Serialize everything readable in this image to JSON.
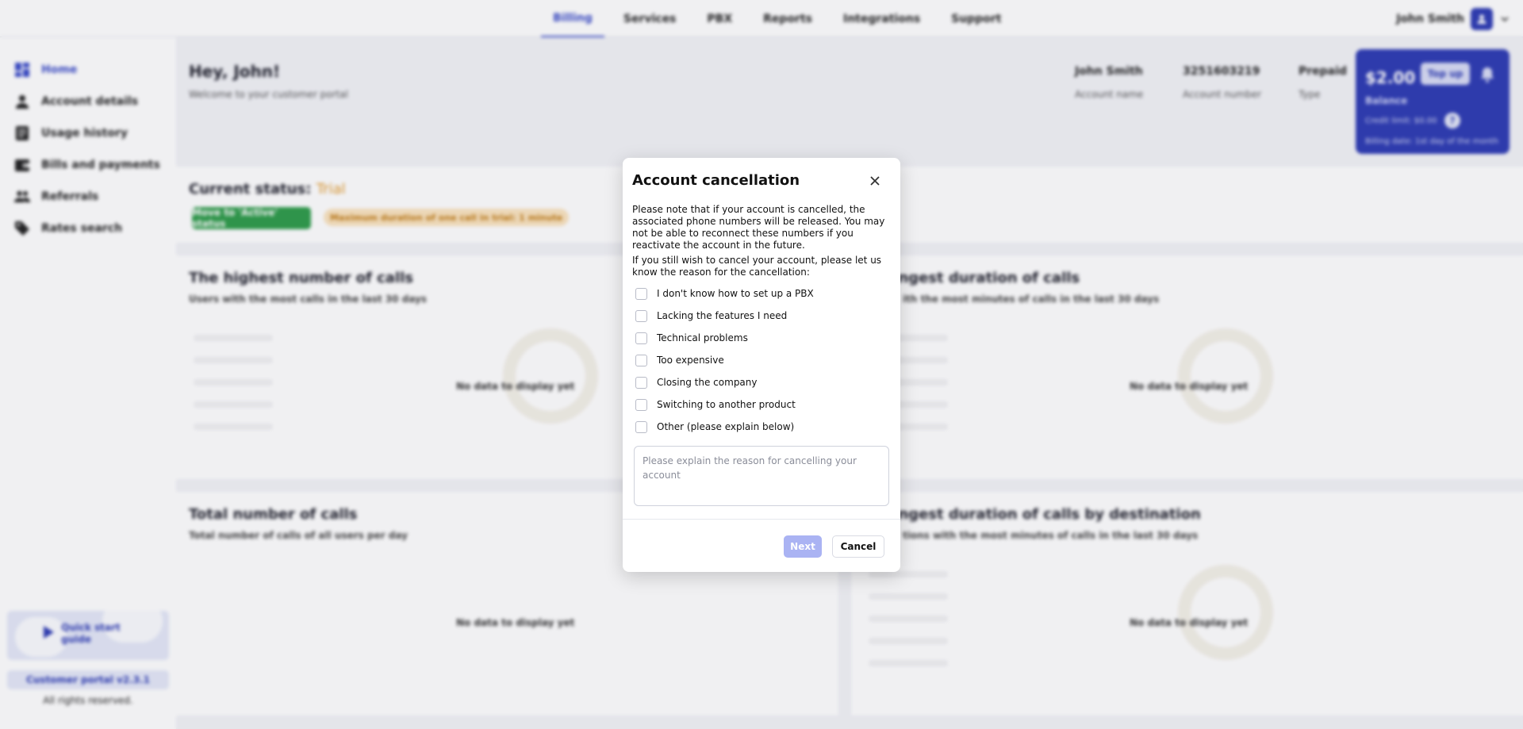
{
  "topnav": {
    "tabs": [
      {
        "label": "Billing",
        "active": true
      },
      {
        "label": "Services",
        "active": false
      },
      {
        "label": "PBX",
        "active": false
      },
      {
        "label": "Reports",
        "active": false
      },
      {
        "label": "Integrations",
        "active": false
      },
      {
        "label": "Support",
        "active": false
      }
    ],
    "user_name": "John Smith"
  },
  "sidebar": {
    "items": [
      {
        "label": "Home",
        "icon": "dashboard-icon",
        "active": true
      },
      {
        "label": "Account details",
        "icon": "user-icon",
        "active": false
      },
      {
        "label": "Usage history",
        "icon": "document-icon",
        "active": false
      },
      {
        "label": "Bills and payments",
        "icon": "wallet-icon",
        "active": false
      },
      {
        "label": "Referrals",
        "icon": "users-icon",
        "active": false
      },
      {
        "label": "Rates search",
        "icon": "tag-icon",
        "active": false
      }
    ],
    "quick_start": "Quick start guide",
    "version": "Customer portal v2.3.1",
    "rights": "All rights reserved."
  },
  "header": {
    "greeting": "Hey, John!",
    "subtitle": "Welcome to your customer portal",
    "account_name_value": "John Smith",
    "account_name_label": "Account name",
    "account_number_value": "3251603219",
    "account_number_label": "Account number",
    "type_value": "Prepaid",
    "type_label": "Type"
  },
  "balance": {
    "amount": "$2.00",
    "topup_label": "Top up",
    "label": "Balance",
    "credit_limit": "Credit limit: $0.00",
    "help": "?",
    "billing_date": "Billing date: 1st day of the month"
  },
  "status": {
    "title_prefix": "Current status:",
    "value": "Trial",
    "active_button": "Move to 'Active' status",
    "trial_note": "Maximum duration of one call in trial: 1 minute"
  },
  "cards": [
    {
      "title": "The highest number of calls",
      "subtitle": "Users with the most calls in the last 30 days",
      "nodata": "No data to display yet"
    },
    {
      "title": "ongest duration of calls",
      "subtitle": "ith the most minutes of calls in the last 30 days",
      "nodata": "No data to display yet"
    },
    {
      "title": "Total number of calls",
      "subtitle": "Total number of calls of all users per day",
      "nodata": "No data to display yet"
    },
    {
      "title": "ongest duration of calls by destination",
      "subtitle": "tions with the most minutes of calls in the last 30 days",
      "nodata": "No data to display yet"
    }
  ],
  "modal": {
    "title": "Account cancellation",
    "paragraph1": "Please note that if your account is cancelled, the associated phone numbers will be released. You may not be able to reconnect these numbers if you reactivate the account in the future.",
    "paragraph2": "If you still wish to cancel your account, please let us know the reason for the cancellation:",
    "reasons": [
      "I don't know how to set up a PBX",
      "Lacking the features I need",
      "Technical problems",
      "Too expensive",
      "Closing the company",
      "Switching to another product",
      "Other (please explain below)"
    ],
    "textarea_placeholder": "Please explain the reason for cancelling your account",
    "next_label": "Next",
    "cancel_label": "Cancel"
  },
  "colors": {
    "accent": "#2d3bb4",
    "trial": "#e39a2c",
    "success": "#2e9c4a"
  }
}
